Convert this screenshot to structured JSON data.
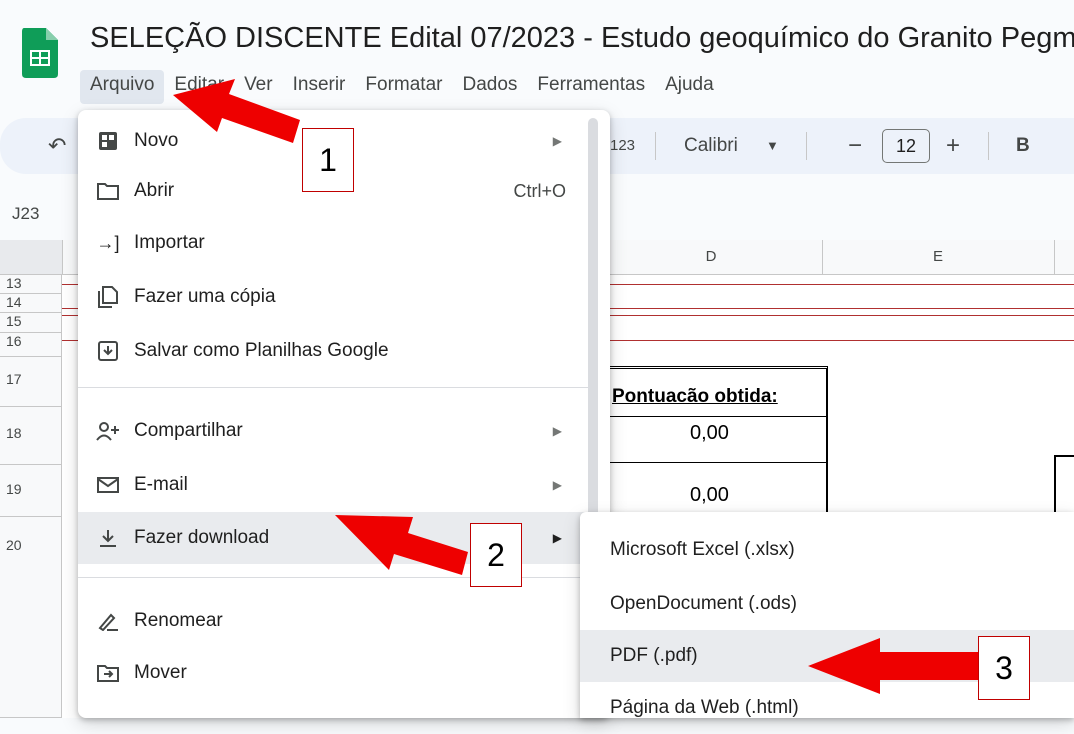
{
  "title": "SELEÇÃO DISCENTE Edital 07/2023 - Estudo geoquímico do Granito Pegm",
  "menubar": [
    "Arquivo",
    "Editar",
    "Ver",
    "Inserir",
    "Formatar",
    "Dados",
    "Ferramentas",
    "Ajuda"
  ],
  "toolbar": {
    "format_number": "123",
    "font": "Calibri",
    "font_size": "12",
    "bold": "B"
  },
  "name_box": "J23",
  "grid": {
    "columns": [
      "D",
      "E"
    ],
    "rows": [
      "13",
      "14",
      "15",
      "16",
      "17",
      "18",
      "19",
      "20"
    ],
    "header_cell": "Pontuacão obtida:",
    "values": [
      "0,00",
      "0,00"
    ]
  },
  "file_menu": {
    "items": [
      {
        "label": "Novo",
        "icon": "new-sheet-icon",
        "has_submenu": true
      },
      {
        "label": "Abrir",
        "icon": "folder-icon",
        "shortcut": "Ctrl+O"
      },
      {
        "label": "Importar",
        "icon": "import-icon"
      },
      {
        "label": "Fazer uma cópia",
        "icon": "copy-icon"
      },
      {
        "label": "Salvar como Planilhas Google",
        "icon": "save-icon"
      },
      {
        "label": "Compartilhar",
        "icon": "share-person-icon",
        "has_submenu": true
      },
      {
        "label": "E-mail",
        "icon": "mail-icon",
        "has_submenu": true
      },
      {
        "label": "Fazer download",
        "icon": "download-icon",
        "has_submenu": true,
        "highlighted": true
      },
      {
        "label": "Renomear",
        "icon": "rename-icon"
      },
      {
        "label": "Mover",
        "icon": "move-folder-icon"
      }
    ]
  },
  "download_submenu": {
    "items": [
      "Microsoft Excel (.xlsx)",
      "OpenDocument (.ods)",
      "PDF (.pdf)",
      "Página da Web (.html)"
    ]
  },
  "annotations": {
    "callouts": [
      "1",
      "2",
      "3"
    ],
    "arrow_color": "#ee0000"
  }
}
